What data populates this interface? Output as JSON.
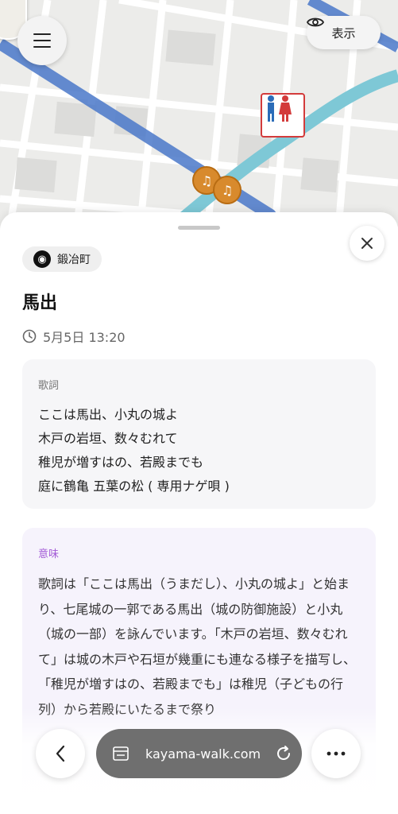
{
  "map": {
    "show_button_label": "表示",
    "icons": {
      "menu": "menu-icon",
      "eye": "eye-icon",
      "toilet": "restroom-icon",
      "music": "music-note-icon"
    },
    "colors": {
      "road_main": "#4a78c9",
      "river": "#7ec8d6",
      "pin_music": "#d88a2d",
      "pin_toilet_border": "#d33b3b"
    }
  },
  "sheet": {
    "chip_label": "鍛冶町",
    "title": "馬出",
    "datetime": "5月5日 13:20",
    "lyrics": {
      "label": "歌詞",
      "lines": [
        "ここは馬出、小丸の城よ",
        "木戸の岩垣、数々むれて",
        "稚児が増すはの、若殿までも",
        "庭に鶴亀 五葉の松 ( 専用ナゲ唄 )"
      ]
    },
    "meaning": {
      "label": "意味",
      "text": "歌詞は「ここは馬出（うまだし）、小丸の城よ」と始まり、七尾城の一郭である馬出（城の防御施設）と小丸（城の一部）を詠んでいます。「木戸の岩垣、数々むれて」は城の木戸や石垣が幾重にも連なる様子を描写し、「稚児が増すはの、若殿までも」は稚児（子どもの行列）から若殿にいたるまで祭り"
    }
  },
  "browser": {
    "url": "kayama-walk.com"
  }
}
